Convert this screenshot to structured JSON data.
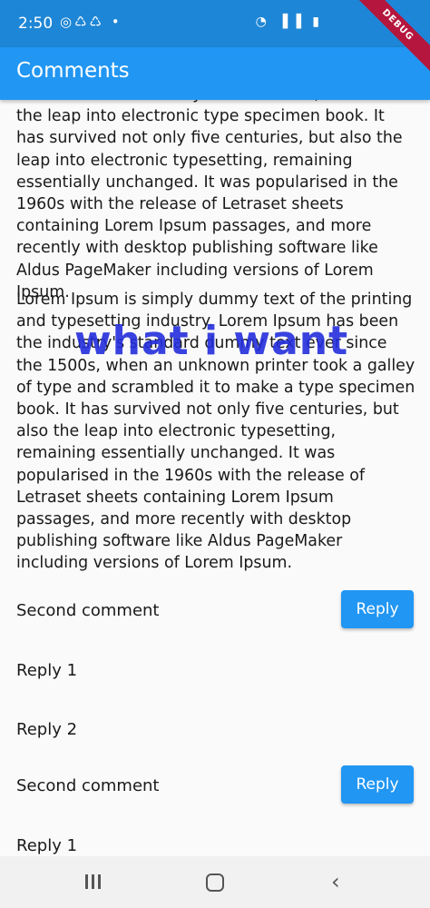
{
  "status_bar": {
    "time": "2:50",
    "left_icons": "◎♺♺ •",
    "right_icons": "◔ ▐▐ ▮"
  },
  "debug_banner": "DEBUG",
  "app_bar": {
    "title": "Comments"
  },
  "comments": {
    "paragraph_1": "It has survived not only five centuries, but also the leap into electronic type specimen book. It has survived not only five centuries, but also the leap into electronic typesetting, remaining essentially unchanged. It was popularised in the 1960s with the release of Letraset sheets containing Lorem Ipsum passages, and more recently with desktop publishing software like Aldus PageMaker including versions of Lorem Ipsum.",
    "paragraph_2": "Lorem Ipsum is simply dummy text of the printing and typesetting industry. Lorem Ipsum has been the industry's standard dummy text ever since the 1500s, when an unknown printer took a galley of type and scrambled it to make a type specimen book. It has survived not only five centuries, but also the leap into electronic typesetting, remaining essentially unchanged. It was popularised in the 1960s with the release of Letraset sheets containing Lorem Ipsum passages, and more recently with desktop publishing software like Aldus PageMaker including versions of Lorem Ipsum.",
    "overlay_annotation": "what i want",
    "rows": [
      {
        "label": "Second comment",
        "button": "Reply"
      },
      {
        "label": "Reply 1"
      },
      {
        "label": "Reply 2"
      },
      {
        "label": "Second comment",
        "button": "Reply"
      },
      {
        "label": "Reply 1"
      }
    ]
  },
  "nav_bar": {
    "back_glyph": "‹"
  }
}
